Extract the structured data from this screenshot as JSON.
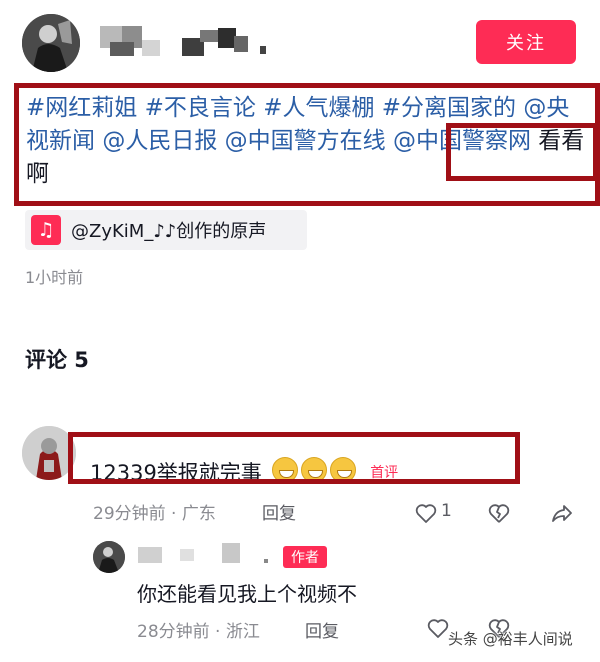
{
  "header": {
    "follow_label": "关注"
  },
  "post": {
    "caption_tags": [
      "#网红莉姐",
      "#不良言论",
      "#人气爆棚",
      "#分离国家的"
    ],
    "caption_mentions": [
      "@央视新闻",
      "@人民日报",
      "@中国警方在线",
      "@中国警察网"
    ],
    "caption_tail": "看看啊",
    "music": "@ZyKiM_♪♪创作的原声",
    "time": "1小时前"
  },
  "comments": {
    "title": "评论 5",
    "items": [
      {
        "text": "12339举报就完事",
        "badge": "首评",
        "time_location": "29分钟前 · 广东",
        "reply_label": "回复",
        "likes": "1"
      }
    ],
    "reply": {
      "author_badge": "作者",
      "text": "你还能看见我上个视频不",
      "time_location": "28分钟前 · 浙江",
      "reply_label": "回复"
    }
  },
  "watermark": "头条 @裕丰人间说",
  "colors": {
    "accent": "#fe2c55",
    "link": "#2b5ea6",
    "annotation_box": "#a00f16"
  }
}
